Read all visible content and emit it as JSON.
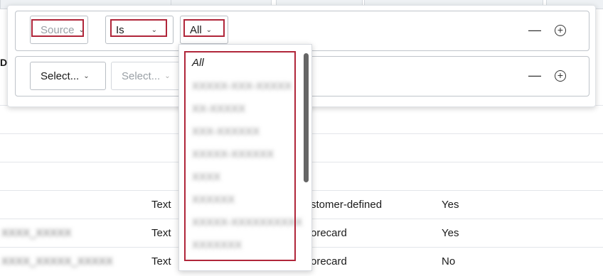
{
  "filter_rows": [
    {
      "source_label": "Source",
      "operator_label": "Is",
      "value_label": "All",
      "remove_symbol": "—",
      "add_symbol": "+"
    },
    {
      "source_label": "Select...",
      "operator_label": "Select...",
      "remove_symbol": "—",
      "add_symbol": "+"
    }
  ],
  "dropdown": {
    "options": [
      "All",
      "XXXXX-XXX-XXXXX",
      "XX-XXXXX",
      "XXX-XXXXXX",
      "XXXXX-XXXXXX",
      "XXXX",
      "XXXXXX",
      "XXXXX-XXXXXXXXXX",
      "XXXXXXX"
    ]
  },
  "background_rows": [
    {
      "name": "",
      "type": "Text",
      "origin": "stomer-defined",
      "flag": "Yes"
    },
    {
      "name": "XXXX_XXXXX",
      "type": "Text",
      "origin": "orecard",
      "flag": "Yes"
    },
    {
      "name": "XXXX_XXXXX_XXXXX",
      "type": "Text",
      "origin": "orecard",
      "flag": "No"
    }
  ],
  "background_header_fragment": "Da",
  "colors": {
    "highlight": "#b0263a",
    "border": "#bfc4ca"
  }
}
